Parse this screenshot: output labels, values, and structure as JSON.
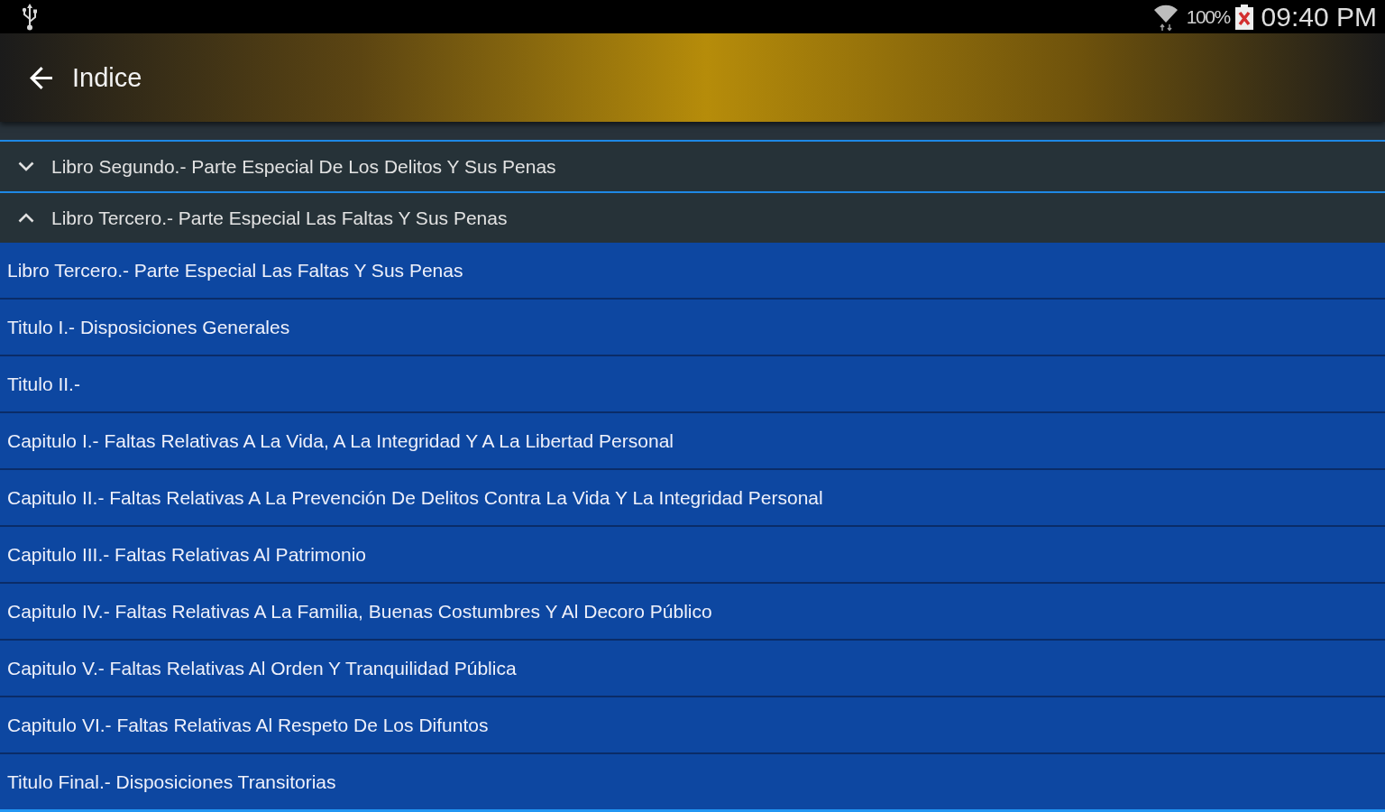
{
  "status_bar": {
    "battery": "100%",
    "time": "09:40 PM"
  },
  "app_bar": {
    "title": "Indice"
  },
  "groups": [
    {
      "title": "Libro Segundo.- Parte Especial De Los Delitos Y Sus Penas",
      "expanded": false
    },
    {
      "title": "Libro Tercero.- Parte Especial Las Faltas Y Sus Penas",
      "expanded": true,
      "children": [
        {
          "title": "Libro Tercero.- Parte Especial Las Faltas Y Sus Penas"
        },
        {
          "title": "Titulo I.- Disposiciones Generales"
        },
        {
          "title": "Titulo II.-"
        },
        {
          "title": "Capitulo I.- Faltas Relativas A La Vida, A La Integridad Y A La Libertad Personal"
        },
        {
          "title": "Capitulo II.- Faltas Relativas A La Prevención De Delitos Contra La Vida Y La Integridad Personal"
        },
        {
          "title": "Capitulo III.- Faltas Relativas Al Patrimonio"
        },
        {
          "title": "Capitulo IV.- Faltas Relativas A La Familia, Buenas Costumbres Y Al Decoro Público"
        },
        {
          "title": "Capitulo V.- Faltas Relativas Al Orden Y Tranquilidad Pública"
        },
        {
          "title": "Capitulo VI.- Faltas Relativas Al Respeto De Los Difuntos"
        },
        {
          "title": "Titulo Final.- Disposiciones Transitorias"
        }
      ]
    }
  ]
}
